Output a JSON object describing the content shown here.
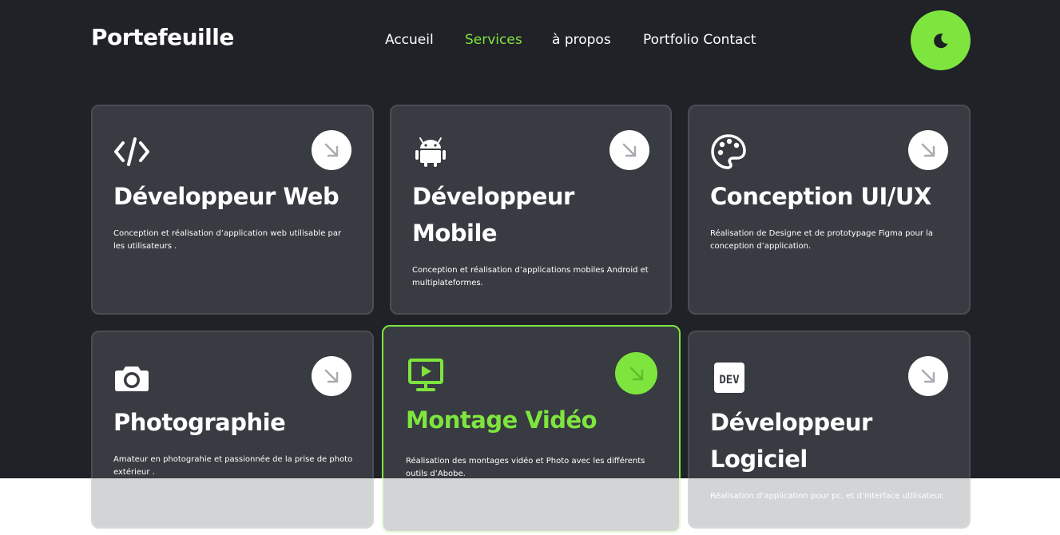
{
  "header": {
    "brand": "Portefeuille",
    "nav": [
      {
        "label": "Accueil",
        "active": false
      },
      {
        "label": "Services",
        "active": true
      },
      {
        "label": "à propos",
        "active": false
      },
      {
        "label": "Portfolio Contact",
        "active": false
      }
    ],
    "theme_icon": "moon-icon"
  },
  "colors": {
    "accent": "#7ee53f",
    "background": "#202227",
    "card": "#383b41",
    "card_border": "#4a4d54"
  },
  "services": [
    {
      "icon": "code-icon",
      "title": "Développeur Web",
      "description": "Conception et réalisation d’application web utilisable par les utilisateurs ."
    },
    {
      "icon": "android-icon",
      "title": "Développeur Mobile",
      "description": "Conception et réalisation d’applications mobiles Android et multiplateformes."
    },
    {
      "icon": "palette-icon",
      "title": "Conception UI/UX",
      "description": "Réalisation de Designe et de prototypage Figma pour la conception d’application."
    },
    {
      "icon": "camera-icon",
      "title": "Photographie",
      "description": "Amateur en photograhie et passionnée de la prise de photo extérieur ."
    },
    {
      "icon": "video-monitor-icon",
      "title": "Montage Vidéo",
      "description": "Réalisation des montages vidéo et Photo avec les différents outils d’Abobe.",
      "active": true
    },
    {
      "icon": "dev-icon",
      "title": "Développeur Logiciel",
      "description": "Réalisation d’application pour pc, et d’interface utilisateur."
    }
  ]
}
